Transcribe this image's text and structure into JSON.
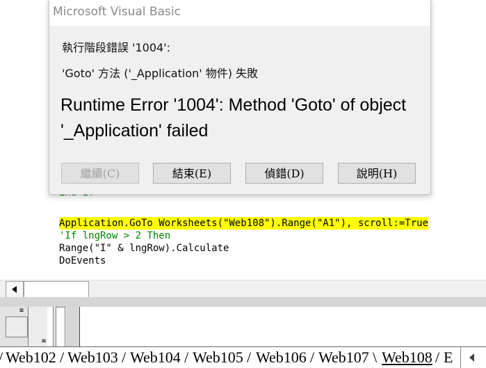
{
  "dialog": {
    "title": "Microsoft Visual Basic",
    "line1": "執行階段錯誤 '1004':",
    "line2": "'Goto' 方法 ('_Application' 物件) 失敗",
    "overlay_text": "Runtime Error '1004': Method 'Goto' of object '_Application' failed",
    "buttons": {
      "continue": "繼續(C)",
      "end": "結束(E)",
      "debug": "偵錯(D)",
      "help": "說明(H)"
    }
  },
  "code": {
    "partial_line": "End If",
    "lines": [
      "Application.GoTo Worksheets(\"Web108\").Range(\"A1\"), scroll:=True",
      "'If lngRow > 2 Then",
      "Range(\"I\" & lngRow).Calculate",
      "DoEvents"
    ]
  },
  "sheet_tabs": {
    "items": [
      "Web102",
      "Web103",
      "Web104",
      "Web105",
      "Web106",
      "Web107",
      "Web108",
      "E"
    ],
    "active": "Web108"
  }
}
